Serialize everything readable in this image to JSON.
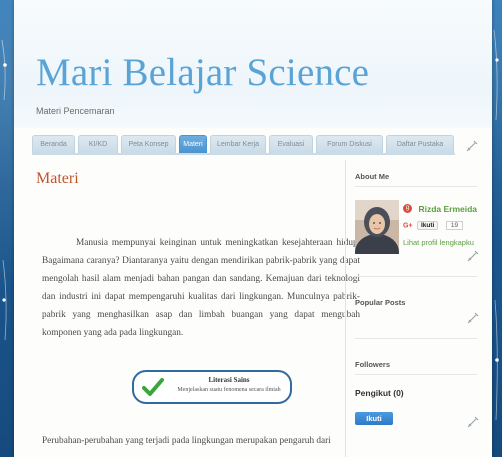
{
  "header": {
    "title": "Mari Belajar Science",
    "description": "Materi Pencemaran"
  },
  "nav": {
    "tabs": [
      {
        "label": "Beranda",
        "active": false
      },
      {
        "label": "KI/KD",
        "active": false
      },
      {
        "label": "Peta Konsep",
        "active": false
      },
      {
        "label": "Materi",
        "active": true
      },
      {
        "label": "Lembar Kerja",
        "active": false
      },
      {
        "label": "Evaluasi",
        "active": false
      },
      {
        "label": "Forum Diskusi",
        "active": false
      },
      {
        "label": "Daftar Pustaka",
        "active": false
      }
    ]
  },
  "post": {
    "title": "Materi",
    "paragraph": "Manusia mempunyai keinginan untuk meningkatkan kesejahteraan hidup. Bagaimana caranya? Diantaranya yaitu dengan mendirikan pabrik-pabrik yang dapat mengolah hasil alam menjadi bahan pangan dan sandang. Kemajuan dari teknologi dan industri ini dapat mempengaruhi kualitas dari lingkungan. Munculnya pabrik-pabrik yang menghasilkan asap dan limbah buangan yang dapat mengubah komponen yang ada pada lingkungan.",
    "badge_title": "Literasi Sains",
    "badge_subtitle": "Menjelaskan suatu fenomena secara ilmiah",
    "tail": "Perubahan-perubahan yang terjadi pada lingkungan merupakan pengaruh dari"
  },
  "sidebar": {
    "about_title": "About Me",
    "profile_name": "Rizda Ermeida",
    "gplus_label": "G+",
    "follow_small_label": "Ikuti",
    "follow_count": "19",
    "profile_link": "Lihat profil lengkapku",
    "popular_title": "Popular Posts",
    "followers_title": "Followers",
    "followers_count": "Pengikut (0)",
    "follow_button": "Ikuti"
  },
  "colors": {
    "accent": "#5aa3d6",
    "post_title": "#c1552e",
    "profile_green": "#5aa03f",
    "tab_active": "#4d93cf"
  },
  "icons": {
    "edit": "wrench-screwdriver-icon",
    "check": "checkmark-icon"
  }
}
